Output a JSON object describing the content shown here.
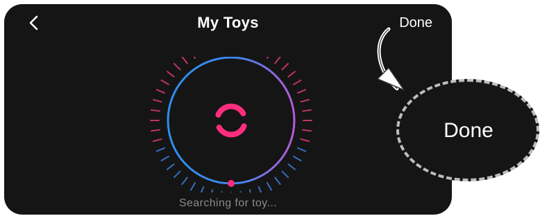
{
  "header": {
    "title": "My Toys",
    "back_icon": "chevron-left-icon",
    "done_label": "Done"
  },
  "scanner": {
    "center_icon": "searching-spinner-icon",
    "status_text": "Searching for toy..."
  },
  "callout": {
    "label": "Done"
  },
  "colors": {
    "background": "#151515",
    "ring_start": "#2d8ff0",
    "ring_end": "#b75bd6",
    "accent_pink": "#ff2d7d",
    "ticks_blue": "#3b7fe0",
    "ticks_pink": "#e03a78"
  }
}
